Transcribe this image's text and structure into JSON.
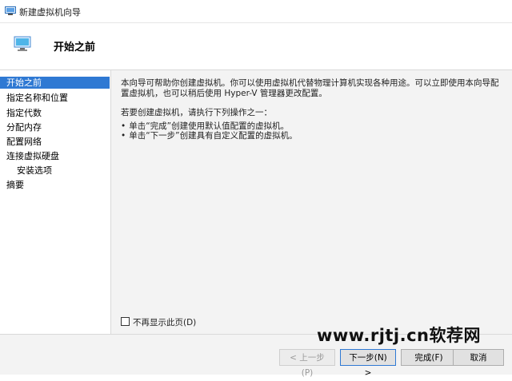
{
  "window": {
    "title": "新建虚拟机向导",
    "icon": "hyper-v-wizard-icon"
  },
  "header": {
    "title": "开始之前",
    "icon": "monitor-icon"
  },
  "sidebar": {
    "items": [
      {
        "label": "开始之前",
        "selected": true
      },
      {
        "label": "指定名称和位置"
      },
      {
        "label": "指定代数"
      },
      {
        "label": "分配内存"
      },
      {
        "label": "配置网络"
      },
      {
        "label": "连接虚拟硬盘"
      },
      {
        "label": "安装选项",
        "sub": true
      },
      {
        "label": "摘要"
      }
    ]
  },
  "content": {
    "intro": "本向导可帮助你创建虚拟机。你可以使用虚拟机代替物理计算机实现各种用途。可以立即使用本向导配置虚拟机，也可以稍后使用 Hyper-V 管理器更改配置。",
    "prompt": "若要创建虚拟机，请执行下列操作之一：",
    "bullets": [
      "单击“完成”创建使用默认值配置的虚拟机。",
      "单击“下一步”创建具有自定义配置的虚拟机。"
    ],
    "checkbox_label": "不再显示此页(D)",
    "checkbox_checked": false
  },
  "buttons": {
    "prev": "< 上一步(P)",
    "next": "下一步(N) >",
    "finish": "完成(F)",
    "cancel": "取消"
  },
  "watermark": "www.rjtj.cn软荐网",
  "colors": {
    "selection": "#2f79d3",
    "panel_bg": "#f3f3f3"
  }
}
